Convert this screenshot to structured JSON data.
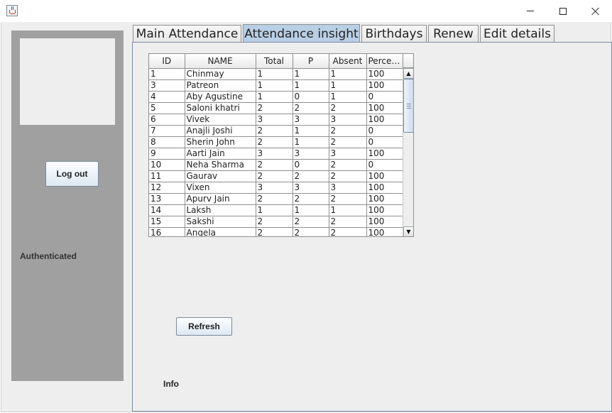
{
  "window": {
    "icon": "java-cup-icon",
    "controls": {
      "minimize": "minimize-icon",
      "maximize": "maximize-icon",
      "close": "close-icon"
    }
  },
  "sidebar": {
    "logout_label": "Log out",
    "status_text": "Authenticated"
  },
  "tabs": [
    {
      "label": "Main Attendance",
      "active": false
    },
    {
      "label": "Attendance insight",
      "active": true
    },
    {
      "label": "Birthdays",
      "active": false
    },
    {
      "label": "Renew",
      "active": false
    },
    {
      "label": "Edit details",
      "active": false
    }
  ],
  "table": {
    "columns": [
      "ID",
      "NAME",
      "Total",
      "P",
      "Absent",
      "Percen..."
    ],
    "rows": [
      [
        "1",
        "Chinmay",
        "1",
        "1",
        "1",
        "100"
      ],
      [
        "3",
        "Patreon",
        "1",
        "1",
        "1",
        "100"
      ],
      [
        "4",
        "Aby Agustine",
        "1",
        "0",
        "1",
        "0"
      ],
      [
        "5",
        "Saloni khatri",
        "2",
        "2",
        "2",
        "100"
      ],
      [
        "6",
        "Vivek",
        "3",
        "3",
        "3",
        "100"
      ],
      [
        "7",
        "Anajli Joshi",
        "2",
        "1",
        "2",
        "0"
      ],
      [
        "8",
        "Sherin John",
        "2",
        "1",
        "2",
        "0"
      ],
      [
        "9",
        "Aarti Jain",
        "3",
        "3",
        "3",
        "100"
      ],
      [
        "10",
        "Neha Sharma",
        "2",
        "0",
        "2",
        "0"
      ],
      [
        "11",
        "Gaurav",
        "2",
        "2",
        "2",
        "100"
      ],
      [
        "12",
        "Vixen",
        "3",
        "3",
        "3",
        "100"
      ],
      [
        "13",
        "Apurv Jain",
        "2",
        "2",
        "2",
        "100"
      ],
      [
        "14",
        "Laksh",
        "1",
        "1",
        "1",
        "100"
      ],
      [
        "15",
        "Sakshi",
        "2",
        "2",
        "2",
        "100"
      ],
      [
        "16",
        "Angela",
        "2",
        "2",
        "2",
        "100"
      ]
    ]
  },
  "actions": {
    "refresh_label": "Refresh"
  },
  "info_label": "Info"
}
